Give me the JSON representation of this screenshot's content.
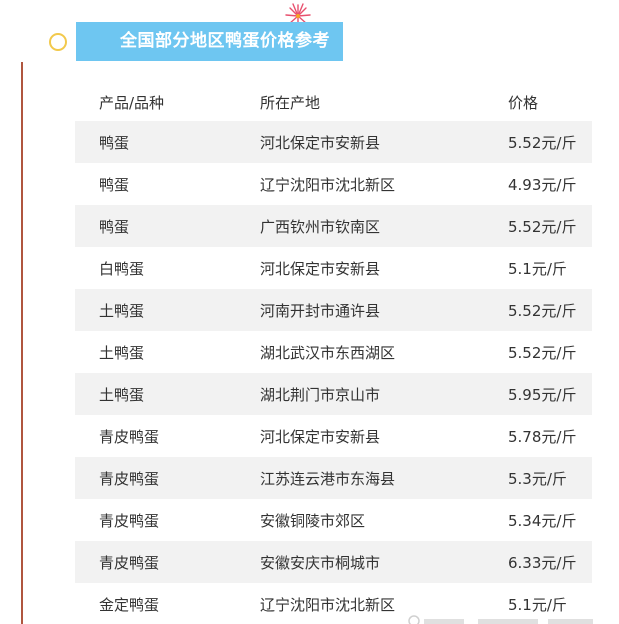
{
  "header": {
    "title": "全国部分地区鸭蛋价格参考"
  },
  "table": {
    "columns": [
      "产品/品种",
      "所在产地",
      "价格"
    ],
    "rows": [
      {
        "product": "鸭蛋",
        "origin": "河北保定市安新县",
        "price": "5.52元/斤"
      },
      {
        "product": "鸭蛋",
        "origin": "辽宁沈阳市沈北新区",
        "price": "4.93元/斤"
      },
      {
        "product": "鸭蛋",
        "origin": "广西钦州市钦南区",
        "price": "5.52元/斤"
      },
      {
        "product": "白鸭蛋",
        "origin": "河北保定市安新县",
        "price": "5.1元/斤"
      },
      {
        "product": "土鸭蛋",
        "origin": "河南开封市通许县",
        "price": "5.52元/斤"
      },
      {
        "product": "土鸭蛋",
        "origin": "湖北武汉市东西湖区",
        "price": "5.52元/斤"
      },
      {
        "product": "土鸭蛋",
        "origin": "湖北荆门市京山市",
        "price": "5.95元/斤"
      },
      {
        "product": "青皮鸭蛋",
        "origin": "河北保定市安新县",
        "price": "5.78元/斤"
      },
      {
        "product": "青皮鸭蛋",
        "origin": "江苏连云港市东海县",
        "price": "5.3元/斤"
      },
      {
        "product": "青皮鸭蛋",
        "origin": "安徽铜陵市郊区",
        "price": "5.34元/斤"
      },
      {
        "product": "青皮鸭蛋",
        "origin": "安徽安庆市桐城市",
        "price": "6.33元/斤"
      },
      {
        "product": "金定鸭蛋",
        "origin": "辽宁沈阳市沈北新区",
        "price": "5.1元/斤"
      }
    ]
  },
  "colors": {
    "banner": "#6ec6f1",
    "row_stripe": "#f2f2f2",
    "left_rule": "#b0563f",
    "bullet": "#f2c94c",
    "sparkle": "#e8506e"
  }
}
